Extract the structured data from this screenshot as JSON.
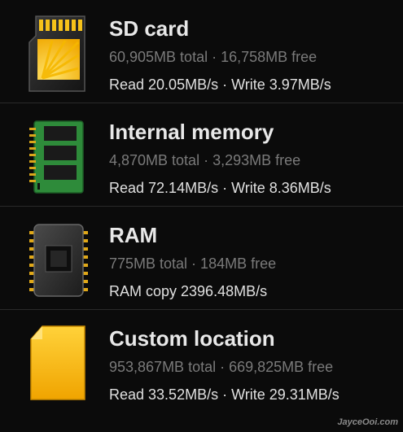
{
  "items": [
    {
      "title": "SD card",
      "subtitle": "60,905MB total · 16,758MB free",
      "speed": "Read 20.05MB/s · Write 3.97MB/s",
      "icon": "sd-card-icon"
    },
    {
      "title": "Internal memory",
      "subtitle": "4,870MB total · 3,293MB free",
      "speed": "Read 72.14MB/s · Write 8.36MB/s",
      "icon": "memory-module-icon"
    },
    {
      "title": "RAM",
      "subtitle": "775MB total · 184MB free",
      "speed": "RAM copy 2396.48MB/s",
      "icon": "ram-chip-icon"
    },
    {
      "title": "Custom location",
      "subtitle": "953,867MB total · 669,825MB free",
      "speed": "Read 33.52MB/s · Write 29.31MB/s",
      "icon": "folder-card-icon"
    }
  ],
  "watermark": "JayceOoi.com",
  "colors": {
    "background": "#0b0b0b",
    "title": "#e8e8e8",
    "subtitle": "#7a7a7a",
    "speed": "#e0e0e0",
    "divider": "#2a2a2a",
    "accent_yellow": "#f6b800",
    "pcb_green": "#2e8b3a"
  }
}
